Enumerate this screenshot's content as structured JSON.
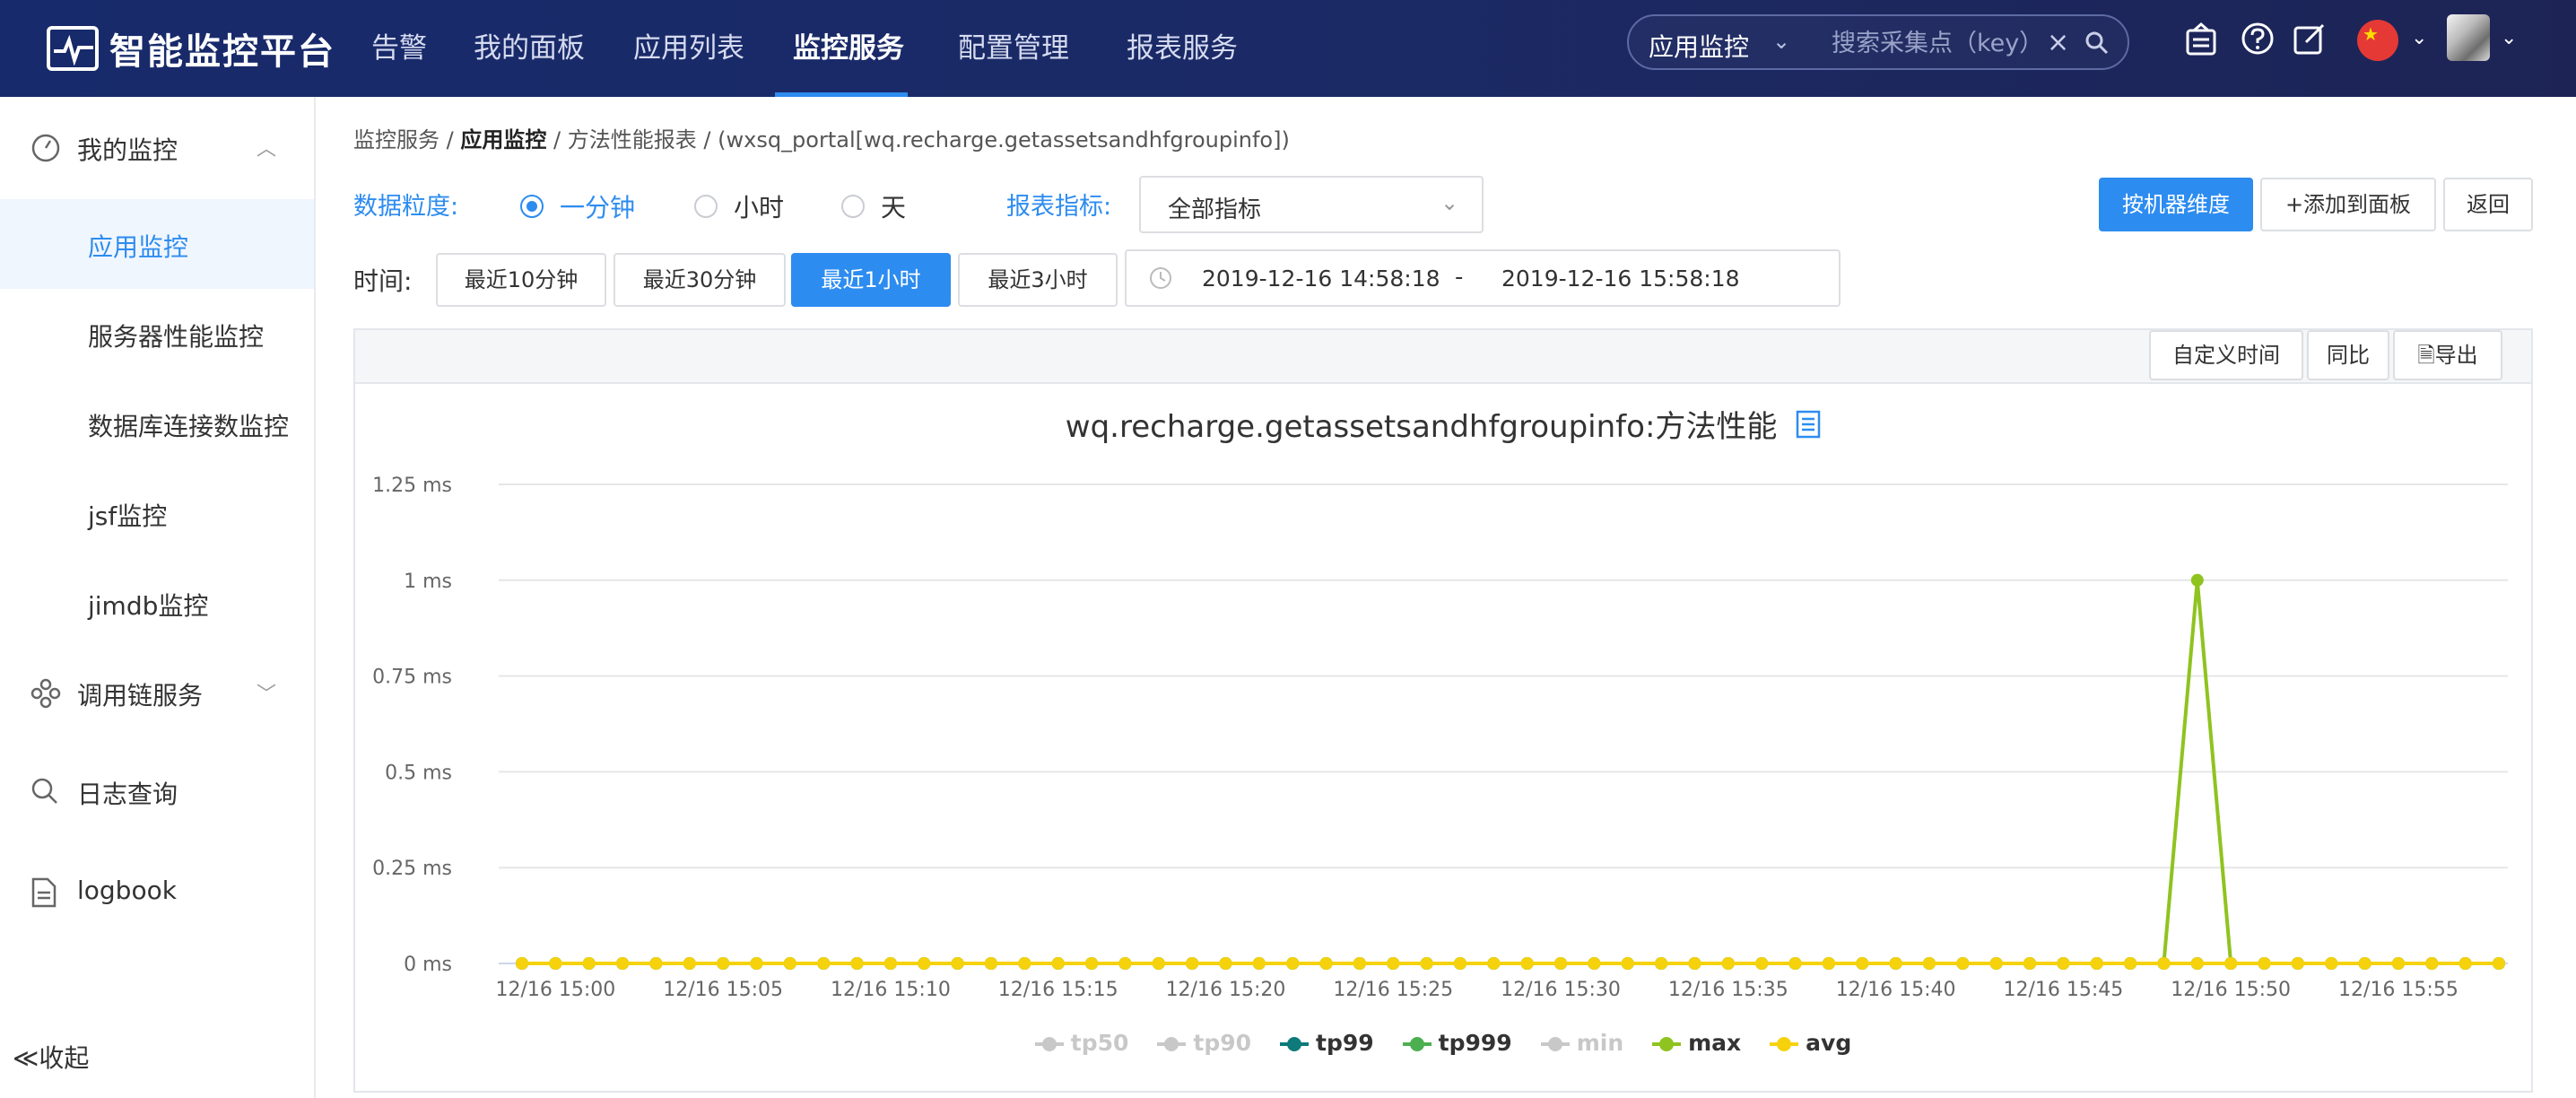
{
  "app": {
    "title": "智能监控平台"
  },
  "nav": {
    "items": [
      {
        "label": "告警"
      },
      {
        "label": "我的面板"
      },
      {
        "label": "应用列表"
      },
      {
        "label": "监控服务",
        "active": true
      },
      {
        "label": "配置管理"
      },
      {
        "label": "报表服务"
      }
    ]
  },
  "search": {
    "category": "应用监控",
    "placeholder": "搜索采集点（key）"
  },
  "sidebar": {
    "my_monitor": "我的监控",
    "items": [
      "应用监控",
      "服务器性能监控",
      "数据库连接数监控",
      "jsf监控",
      "jimdb监控"
    ],
    "call_chain": "调用链服务",
    "log_query": "日志查询",
    "logbook": "logbook",
    "collapse": "收起"
  },
  "breadcrumb": {
    "p1": "监控服务",
    "p2": "应用监控",
    "p3": "方法性能报表",
    "p4": "(wxsq_portal[wq.recharge.getassetsandhfgroupinfo])",
    "sep": "/"
  },
  "filters": {
    "granularity_label": "数据粒度:",
    "granularity": [
      "一分钟",
      "小时",
      "天"
    ],
    "granularity_selected": "一分钟",
    "metric_label": "报表指标:",
    "metric_value": "全部指标"
  },
  "actions": {
    "by_machine": "按机器维度",
    "add_to_panel": "+添加到面板",
    "back": "返回"
  },
  "time": {
    "label": "时间:",
    "presets": [
      "最近10分钟",
      "最近30分钟",
      "最近1小时",
      "最近3小时"
    ],
    "selected": "最近1小时",
    "from": "2019-12-16 14:58:18",
    "separator": "-",
    "to": "2019-12-16 15:58:18"
  },
  "panel": {
    "custom_time": "自定义时间",
    "compare": "同比",
    "export": "导出"
  },
  "colors": {
    "accent": "#2d8cf0",
    "max": "#8fc31f",
    "avg": "#f5d20c",
    "tp99": "#0e7a7a",
    "tp999": "#4caf50",
    "disabled": "#c8c8c8"
  },
  "chart_data": {
    "type": "line",
    "title": "wq.recharge.getassetsandhfgroupinfo:方法性能",
    "y_unit": "ms",
    "ylim": [
      0,
      1.25
    ],
    "y_ticks": [
      "0 ms",
      "0.25 ms",
      "0.5 ms",
      "0.75 ms",
      "1 ms",
      "1.25 ms"
    ],
    "x_ticks": [
      "12/16 15:00",
      "12/16 15:05",
      "12/16 15:10",
      "12/16 15:15",
      "12/16 15:20",
      "12/16 15:25",
      "12/16 15:30",
      "12/16 15:35",
      "12/16 15:40",
      "12/16 15:45",
      "12/16 15:50",
      "12/16 15:55"
    ],
    "x_start": "12/16 14:59",
    "x_end": "12/16 15:58",
    "interval_minutes": 1,
    "series": [
      {
        "name": "tp50",
        "visible": false,
        "values": []
      },
      {
        "name": "tp90",
        "visible": false,
        "values": []
      },
      {
        "name": "tp99",
        "visible": true,
        "values": [
          0,
          0,
          0,
          0,
          0,
          0,
          0,
          0,
          0,
          0,
          0,
          0,
          0,
          0,
          0,
          0,
          0,
          0,
          0,
          0,
          0,
          0,
          0,
          0,
          0,
          0,
          0,
          0,
          0,
          0,
          0,
          0,
          0,
          0,
          0,
          0,
          0,
          0,
          0,
          0,
          0,
          0,
          0,
          0,
          0,
          0,
          0,
          0,
          0,
          0,
          0,
          0,
          0,
          0,
          0,
          0,
          0,
          0,
          0,
          0
        ]
      },
      {
        "name": "tp999",
        "visible": true,
        "values": [
          0,
          0,
          0,
          0,
          0,
          0,
          0,
          0,
          0,
          0,
          0,
          0,
          0,
          0,
          0,
          0,
          0,
          0,
          0,
          0,
          0,
          0,
          0,
          0,
          0,
          0,
          0,
          0,
          0,
          0,
          0,
          0,
          0,
          0,
          0,
          0,
          0,
          0,
          0,
          0,
          0,
          0,
          0,
          0,
          0,
          0,
          0,
          0,
          0,
          0,
          0,
          0,
          0,
          0,
          0,
          0,
          0,
          0,
          0,
          0
        ]
      },
      {
        "name": "min",
        "visible": false,
        "values": []
      },
      {
        "name": "max",
        "visible": true,
        "values": [
          0,
          0,
          0,
          0,
          0,
          0,
          0,
          0,
          0,
          0,
          0,
          0,
          0,
          0,
          0,
          0,
          0,
          0,
          0,
          0,
          0,
          0,
          0,
          0,
          0,
          0,
          0,
          0,
          0,
          0,
          0,
          0,
          0,
          0,
          0,
          0,
          0,
          0,
          0,
          0,
          0,
          0,
          0,
          0,
          0,
          0,
          0,
          0,
          0,
          0,
          1,
          0,
          0,
          0,
          0,
          0,
          0,
          0,
          0,
          0
        ]
      },
      {
        "name": "avg",
        "visible": true,
        "values": [
          0,
          0,
          0,
          0,
          0,
          0,
          0,
          0,
          0,
          0,
          0,
          0,
          0,
          0,
          0,
          0,
          0,
          0,
          0,
          0,
          0,
          0,
          0,
          0,
          0,
          0,
          0,
          0,
          0,
          0,
          0,
          0,
          0,
          0,
          0,
          0,
          0,
          0,
          0,
          0,
          0,
          0,
          0,
          0,
          0,
          0,
          0,
          0,
          0,
          0,
          0,
          0,
          0,
          0,
          0,
          0,
          0,
          0,
          0,
          0
        ]
      }
    ]
  }
}
